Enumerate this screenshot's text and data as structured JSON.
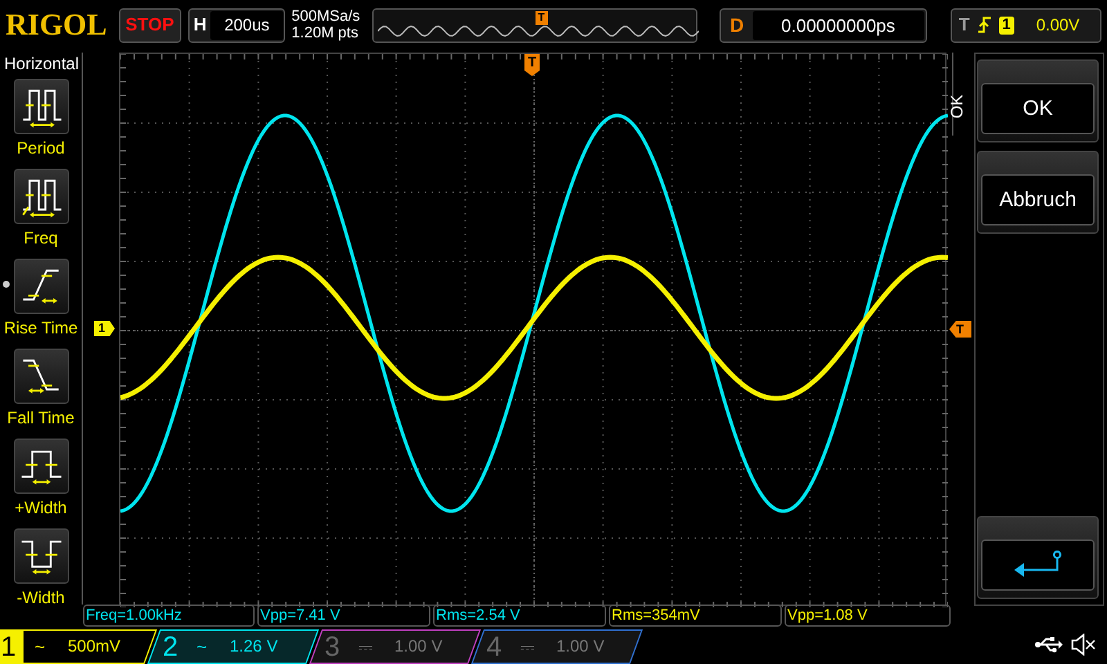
{
  "top_bar": {
    "logo": "RIGOL",
    "run_state": "STOP",
    "timebase_label": "H",
    "timebase": "200us",
    "sample_rate": "500MSa/s",
    "memory_depth": "1.20M pts",
    "overview_marker": "T",
    "delay_label": "D",
    "delay": "0.00000000ps",
    "trigger_label": "T",
    "trigger_source": "1",
    "trigger_level": "0.00V"
  },
  "menu": {
    "title": "Horizontal",
    "items": [
      {
        "kind": "period",
        "label": "Period"
      },
      {
        "kind": "freq",
        "label": "Freq"
      },
      {
        "kind": "rise",
        "label": "Rise Time"
      },
      {
        "kind": "fall",
        "label": "Fall Time"
      },
      {
        "kind": "pwidth",
        "label": "+Width"
      },
      {
        "kind": "nwidth",
        "label": "-Width"
      }
    ]
  },
  "screen": {
    "trigger_position_marker": "T",
    "channel_marker": "1",
    "trigger_level_marker": "T"
  },
  "side_tab": "OK",
  "softkeys": [
    {
      "kind": "text",
      "label": "OK"
    },
    {
      "kind": "text",
      "label": "Abbruch"
    },
    {
      "kind": "enter"
    }
  ],
  "measurements": [
    {
      "text": "Freq=1.00kHz",
      "color": "#00e5ee"
    },
    {
      "text": "Vpp=7.41 V",
      "color": "#00e5ee"
    },
    {
      "text": "Rms=2.54 V",
      "color": "#00e5ee"
    },
    {
      "text": "Rms=354mV",
      "color": "#f5f000"
    },
    {
      "text": "Vpp=1.08 V",
      "color": "#f5f000"
    }
  ],
  "channels": [
    {
      "number": "1",
      "coupling": "~",
      "scale": "500mV",
      "on": true,
      "selected": true,
      "color": "#f5f000"
    },
    {
      "number": "2",
      "coupling": "~",
      "scale": "1.26 V",
      "on": true,
      "selected": false,
      "color": "#00e5ee"
    },
    {
      "number": "3",
      "coupling": "⎓",
      "scale": "1.00 V",
      "on": false,
      "selected": false,
      "color": "#c040c0"
    },
    {
      "number": "4",
      "coupling": "⎓",
      "scale": "1.00 V",
      "on": false,
      "selected": false,
      "color": "#3070d0"
    }
  ]
}
